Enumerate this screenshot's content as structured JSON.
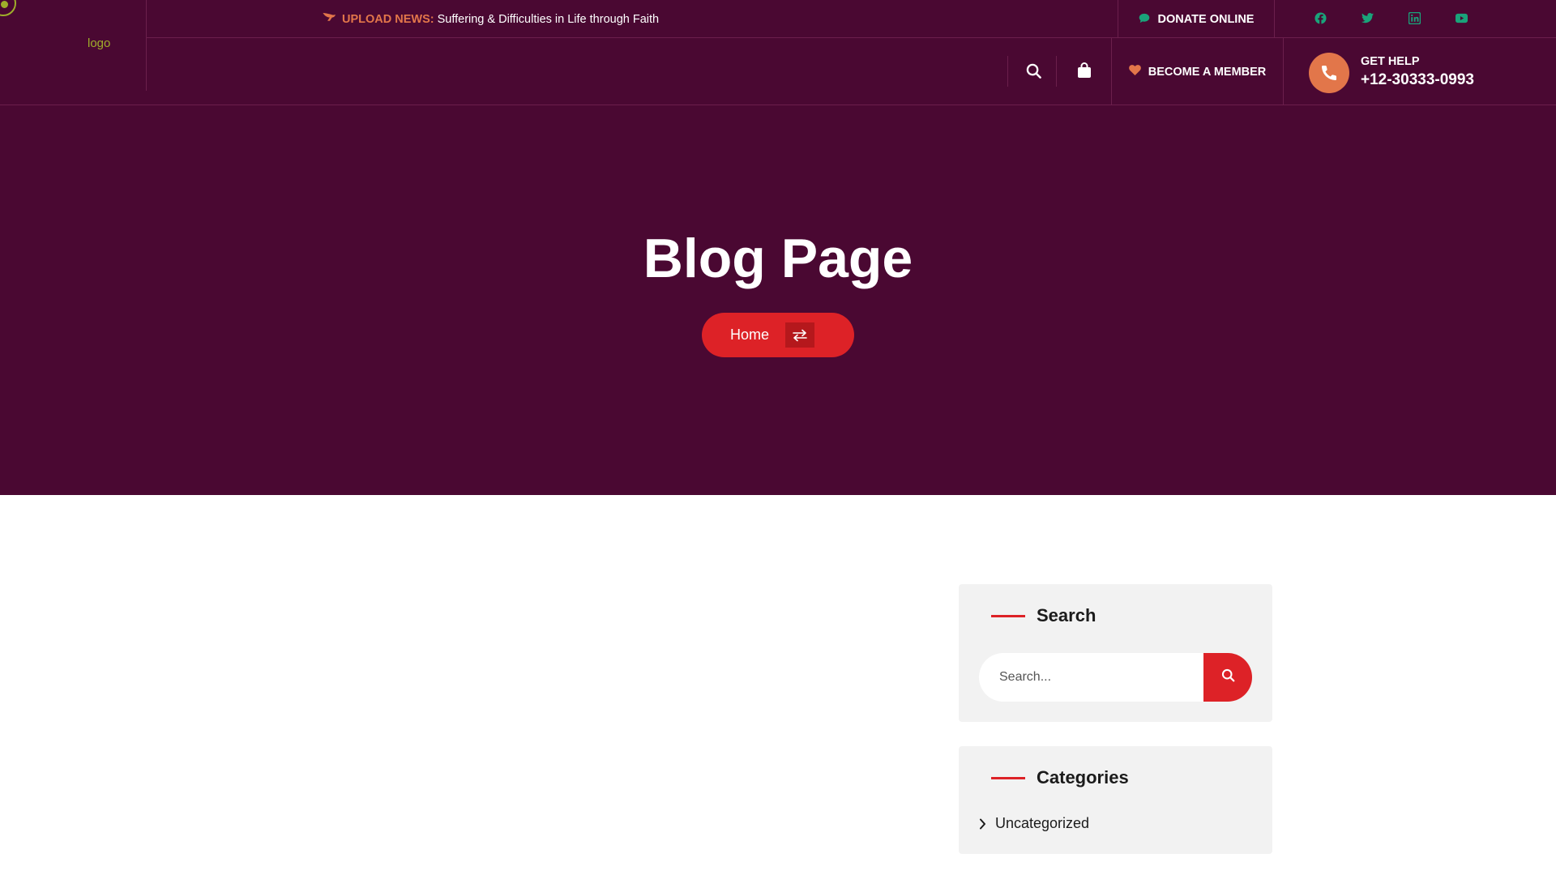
{
  "header": {
    "logo_alt": "logo",
    "news": {
      "icon": "dove-icon",
      "label": "UPLOAD NEWS:",
      "text": "Suffering & Difficulties in Life through Faith"
    },
    "donate": {
      "icon": "chat-bubble-icon",
      "label": "DONATE ONLINE"
    },
    "socials": [
      "facebook-icon",
      "twitter-icon",
      "linkedin-icon",
      "youtube-icon"
    ],
    "nav_icons": [
      "search-icon",
      "shopping-bag-icon"
    ],
    "member": {
      "icon": "heart-icon",
      "label": "BECOME A MEMBER"
    },
    "help": {
      "icon": "phone-icon",
      "label": "GET HELP",
      "phone": "+12-30333-0993"
    }
  },
  "hero": {
    "title": "Blog Page",
    "breadcrumb": {
      "home": "Home",
      "separator_icon": "swap-arrows-icon"
    }
  },
  "sidebar": {
    "search": {
      "title": "Search",
      "placeholder": "Search...",
      "button_icon": "search-icon"
    },
    "categories": {
      "title": "Categories",
      "items": [
        "Uncategorized"
      ]
    }
  },
  "colors": {
    "header_bg": "#4a0832",
    "accent_orange": "#e2764a",
    "accent_green": "#1aa37a",
    "primary_red": "#dd2227",
    "widget_bg": "#f2f2f2"
  }
}
